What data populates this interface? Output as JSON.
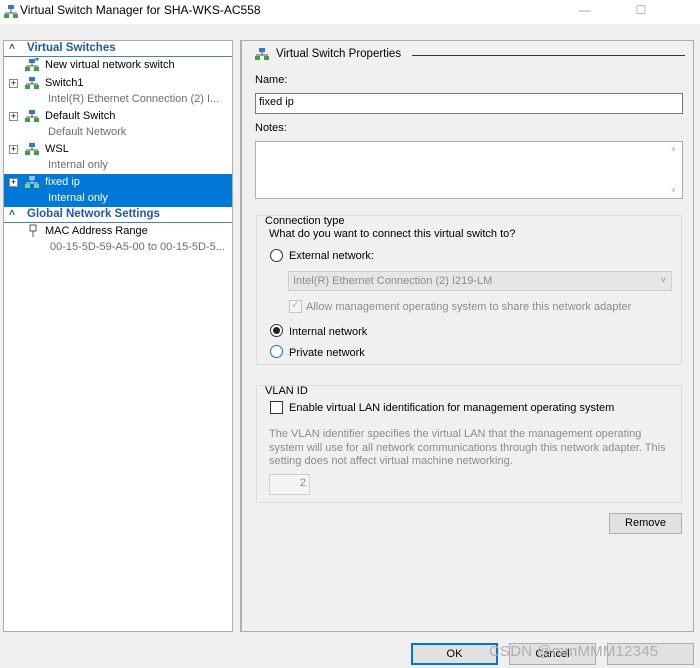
{
  "window": {
    "title": "Virtual Switch Manager for SHA-WKS-AC558",
    "minimize": "—",
    "maximize": "☐"
  },
  "tree": {
    "virtual_switches_header": "Virtual Switches",
    "new_switch": "New virtual network switch",
    "switches": [
      {
        "name": "Switch1",
        "detail": "Intel(R) Ethernet Connection (2) I..."
      },
      {
        "name": "Default Switch",
        "detail": "Default Network"
      },
      {
        "name": "WSL",
        "detail": "Internal only"
      },
      {
        "name": "fixed ip",
        "detail": "Internal only"
      }
    ],
    "global_header": "Global Network Settings",
    "mac_range": {
      "name": "MAC Address Range",
      "detail": "00-15-5D-59-A5-00 to 00-15-5D-5..."
    }
  },
  "props": {
    "header": "Virtual Switch Properties",
    "name_label": "Name:",
    "name_value": "fixed ip",
    "notes_label": "Notes:",
    "notes_value": "",
    "connection_type": {
      "title": "Connection type",
      "question": "What do you want to connect this virtual switch to?",
      "external": "External network:",
      "adapter": "Intel(R) Ethernet Connection (2) I219-LM",
      "allow_mgmt": "Allow management operating system to share this network adapter",
      "internal": "Internal network",
      "private": "Private network",
      "selected": "internal"
    },
    "vlan": {
      "title": "VLAN ID",
      "enable_label": "Enable virtual LAN identification for management operating system",
      "description": "The VLAN identifier specifies the virtual LAN that the management operating system will use for all network communications through this network adapter. This setting does not affect virtual machine networking.",
      "vlan_value": "2"
    },
    "remove_button": "Remove"
  },
  "footer": {
    "ok_button": "OK",
    "cancel_button": "Cancel",
    "watermark": "CSDN @mmMMM12345"
  },
  "colors": {
    "selection": "#0078d7",
    "section_header": "#1e5aa8"
  }
}
